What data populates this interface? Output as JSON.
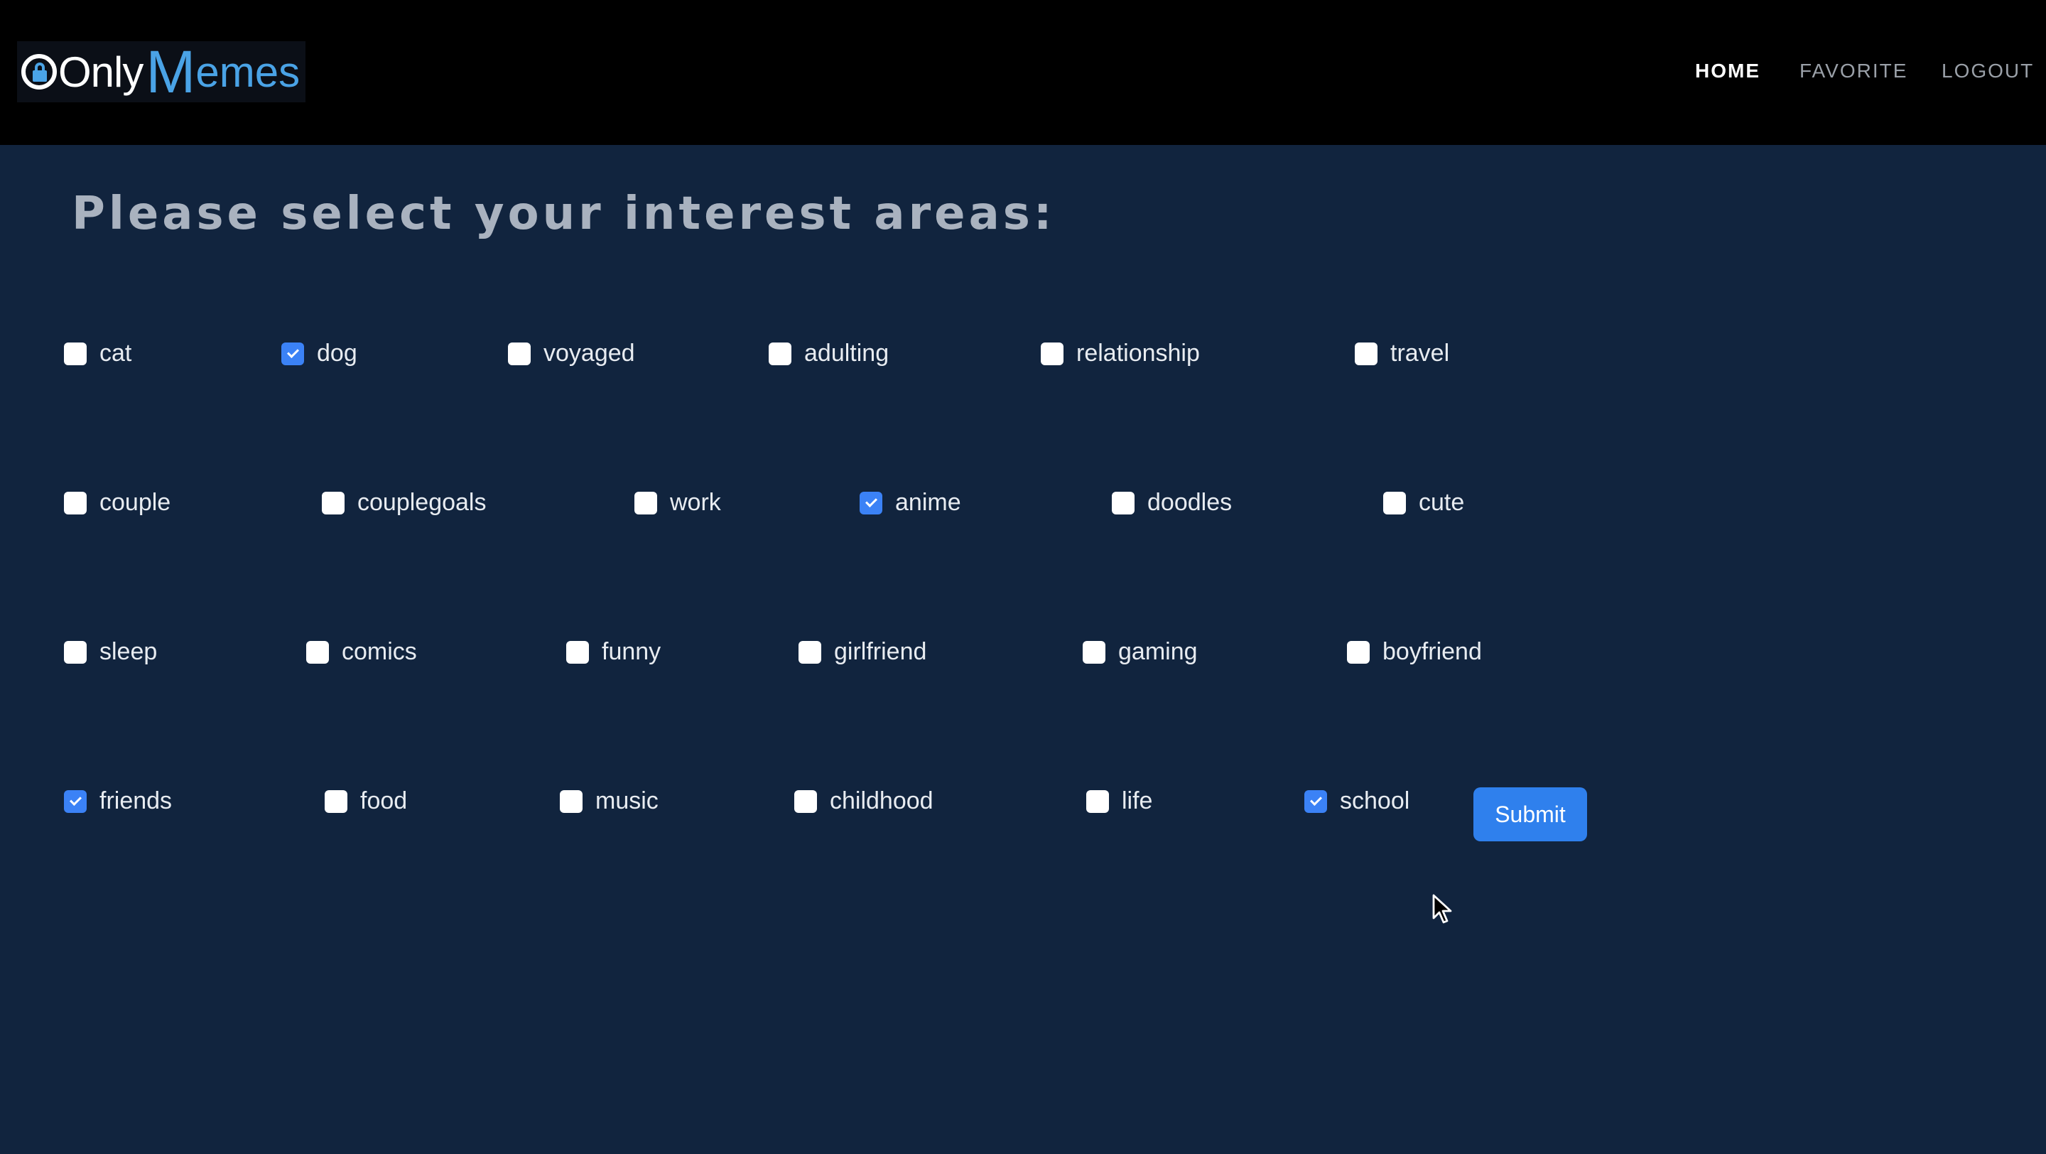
{
  "header": {
    "logo": {
      "only": "Only",
      "m": "M",
      "emes": "emes"
    },
    "nav": [
      {
        "label": "HOME",
        "active": true
      },
      {
        "label": "FAVORITE",
        "active": false
      },
      {
        "label": "LOGOUT",
        "active": false
      }
    ]
  },
  "form": {
    "heading": "Please select your interest areas:",
    "options": [
      {
        "label": "cat",
        "checked": false
      },
      {
        "label": "dog",
        "checked": true
      },
      {
        "label": "voyaged",
        "checked": false
      },
      {
        "label": "adulting",
        "checked": false
      },
      {
        "label": "relationship",
        "checked": false
      },
      {
        "label": "travel",
        "checked": false
      },
      {
        "label": "couple",
        "checked": false
      },
      {
        "label": "couplegoals",
        "checked": false
      },
      {
        "label": "work",
        "checked": false
      },
      {
        "label": "anime",
        "checked": true
      },
      {
        "label": "doodles",
        "checked": false
      },
      {
        "label": "cute",
        "checked": false
      },
      {
        "label": "sleep",
        "checked": false
      },
      {
        "label": "comics",
        "checked": false
      },
      {
        "label": "funny",
        "checked": false
      },
      {
        "label": "girlfriend",
        "checked": false
      },
      {
        "label": "gaming",
        "checked": false
      },
      {
        "label": "boyfriend",
        "checked": false
      },
      {
        "label": "friends",
        "checked": true
      },
      {
        "label": "food",
        "checked": false
      },
      {
        "label": "music",
        "checked": false
      },
      {
        "label": "childhood",
        "checked": false
      },
      {
        "label": "life",
        "checked": false
      },
      {
        "label": "school",
        "checked": true
      }
    ],
    "submit_label": "Submit"
  },
  "colors": {
    "page_background": "#11243e",
    "navbar_background": "#000000",
    "accent": "#2f80ed",
    "logo_blue": "#4aa3e6",
    "heading": "#a9b2bf"
  },
  "icons": {
    "logo": "lock-icon",
    "pointer": "mouse-cursor-icon"
  }
}
